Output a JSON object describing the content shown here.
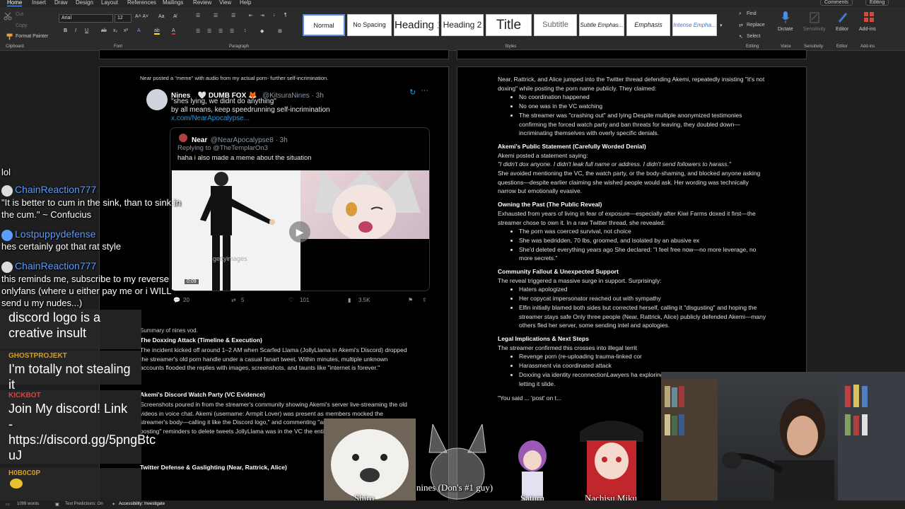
{
  "ribbon": {
    "tabs": [
      "Home",
      "Insert",
      "Draw",
      "Design",
      "Layout",
      "References",
      "Mailings",
      "Review",
      "View",
      "Help"
    ],
    "comments_label": "Comments",
    "editing_label": "Editing",
    "clipboard": {
      "cut": "Cut",
      "copy": "Copy",
      "format_painter": "Format Painter",
      "group": "Clipboard"
    },
    "font": {
      "name": "Arial",
      "size": "12",
      "group": "Font"
    },
    "paragraph_group": "Paragraph",
    "styles_group": "Styles",
    "styles": [
      "Normal",
      "No Spacing",
      "Heading 1",
      "Heading 2",
      "Title",
      "Subtitle",
      "Subtle Emphas...",
      "Emphasis",
      "Intense Empha..."
    ],
    "editing": {
      "find": "Find",
      "replace": "Replace",
      "select": "Select",
      "group": "Editing"
    },
    "voice": {
      "dictate": "Dictate",
      "group": "Voice"
    },
    "sensitivity": {
      "label": "Sensitivity",
      "group": "Sensitivity"
    },
    "editor": {
      "label": "Editor",
      "group": "Editor"
    },
    "addins": {
      "label": "Add-ins",
      "group": "Add-ins"
    }
  },
  "left_page": {
    "caption": "Near posted a \"meme\" with audio from my actual porn- further self-incrimination.",
    "tweet": {
      "name": "Nines",
      "name_suffix": "🤍 DUMB FOX 🦊",
      "handle": "@KitsuraNines · 3h",
      "text1": "\"shes lying, we didnt do anything\"",
      "text2": "by all means, keep speedrunning self-incrimination",
      "link": "x.com/NearApocalypse...",
      "quote_name": "Near",
      "quote_handle": "@NearApocalypse8 · 3h",
      "quote_reply": "Replying to @TheTemplarOn3",
      "quote_text": "haha i also made a meme about the situation",
      "watermark": "gettyimages",
      "video_time": "0:09",
      "stats": {
        "replies": "20",
        "retweets": "5",
        "likes": "101",
        "views": "3.5K"
      }
    },
    "summary_title": "Summary of nines vod.",
    "section1_title": "The Doxxing Attack (Timeline & Execution)",
    "section1_text": "The incident kicked off around 1–2 AM when Scarfed Llama (JollyLlama in Akemi's Discord) dropped the streamer's old porn handle under a casual fanart tweet. Within minutes, multiple unknown accounts flooded the replies with images, screenshots, and taunts like \"internet is forever.\"",
    "section2_title": "Akemi's Discord Watch Party (VC Evidence)",
    "section2_text": "Screenshots poured in from the streamer's community showing Akemi's server live-streaming the old videos in voice chat. Akemi (username: Armpit Lover) was present as members mocked the streamer's body—calling it like the Discord logo,\" and commenting \"anything issued \"clean up after posting\" reminders to delete tweets JollyLlama was in the VC the entire time, confirming coord",
    "section3_title": "Twitter Defense & Gaslighting (Near, Rattrick, Alice)"
  },
  "right_page": {
    "p1": "Near, Rattrick, and Alice jumped into the Twitter thread defending Akemi, repeatedly insisting \"it's not doxing\" while posting the porn name publicly. They claimed:",
    "p1_items": [
      "No coordination happened",
      "No one was in the VC watching",
      "The streamer was \"crashing out\" and lying Despite multiple anonymized testimonies confirming the forced watch party and ban threats for leaving, they doubled down—incriminating themselves with overly specific denials."
    ],
    "h2": "Akemi's Public Statement (Carefully Worded Denial)",
    "p2a": "Akemi posted a statement saying:",
    "p2b": "\"I didn't dox anyone. I didn't leak full name or address. I didn't send followers to harass.\"",
    "p2c": "She avoided mentioning the VC, the watch party, or the body-shaming, and blocked anyone asking questions—despite earlier claiming she wished people would ask. Her wording was technically narrow but emotionally evasive.",
    "h3": "Owning the Past (The Public Reveal)",
    "p3": "Exhausted from years of living in fear of exposure—especially after Kiwi Farms doxed it first—the streamer chose to own it. In a raw Twitter thread, she revealed:",
    "p3_items": [
      "The porn was coerced survival, not choice",
      "She was bedridden, 70 lbs, groomed, and isolated by an abusive ex",
      "She'd deleted everything years ago She declared: \"I feel free now—no more leverage, no more secrets.\""
    ],
    "h4": "Community Fallout & Unexpected Support",
    "p4": "The reveal triggered a massive surge in support. Surprisingly:",
    "p4_items": [
      "Haters apologized",
      "Her copycat impersonator reached out with sympathy",
      "Elfin initially blamed both sides but corrected herself, calling it \"disgusting\" and hoping the streamer stays safe Only three people (Near, Rattrick, Alice) publicly defended Akemi—many others fled her server, some sending intel and apologies."
    ],
    "h5": "Legal Implications & Next Steps",
    "p5": "The streamer confirmed this crosses into illegal territ",
    "p5_items": [
      "Revenge porn (re-uploading trauma-linked cor",
      "Harassment via coordinated attack",
      "Doxxing via identity reconnectionLawyers ha exploring cross-country legal action despite not letting it slide."
    ],
    "p6": "\"You said ... 'post' on t..."
  },
  "chat_top": [
    {
      "user": "",
      "text": "lol"
    },
    {
      "user": "ChainReaction777",
      "text": "\"It is better to cum in the sink, than to sink in the cum.\" ~ Confucius"
    },
    {
      "user": "Lostpuppydefense",
      "text": "hes certainly got that rat style"
    },
    {
      "user": "ChainReaction777",
      "text": "this reminds me, subscribe to my reverse onlyfans (where u either pay me or i WILL send u my nudes...)"
    }
  ],
  "chat_bottom": [
    {
      "user": "",
      "text": "discord logo is a creative insult",
      "color": "#ffffff"
    },
    {
      "user": "GHOSTPROJEKT",
      "text": "I'm totally not stealing it",
      "color": "#d4a017"
    },
    {
      "user": "KICKBOT",
      "text": "Join My discord! Link - https://discord.gg/5pngBtc uJ",
      "color": "#e04040"
    },
    {
      "user": "H0B0C0P",
      "text": "",
      "color": "#d4a017"
    }
  ],
  "avatars": [
    "Shiro",
    "nines (Don's #1 guy)",
    "Saturn",
    "Nachisu Miku"
  ],
  "status": {
    "words": "1099 words",
    "predictions": "Text Predictions: On",
    "accessibility": "Accessibility: Investigate"
  },
  "colors": {
    "accent": "#5a8ddb",
    "link": "#1d9bf0",
    "chat_user": "#5c9dff"
  }
}
